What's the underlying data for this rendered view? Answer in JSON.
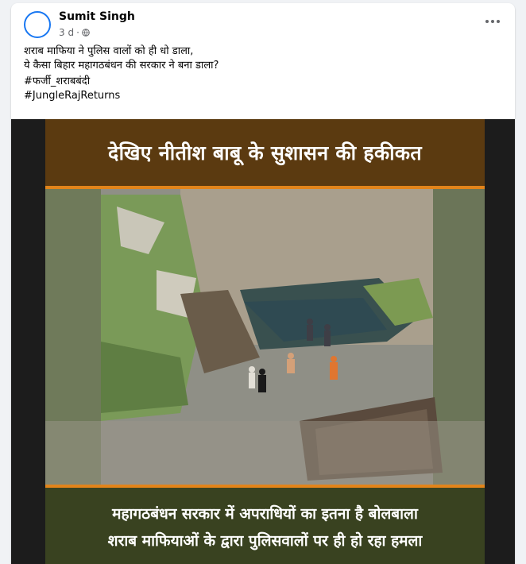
{
  "post": {
    "author": "Sumit Singh",
    "time": "3 d",
    "separator": "·",
    "lines": [
      "शराब माफिया ने पुलिस वालों को ही धो डाला,",
      "ये कैसा बिहार महागठबंधन की सरकार ने बना डाला?"
    ],
    "hashtags": [
      "#फर्जी_शराबबंदी",
      "#JungleRajReturns"
    ]
  },
  "icons": {
    "privacy": "globe-icon",
    "menu": "more-options-icon"
  },
  "video": {
    "top_caption": "देखिए नीतीश बाबू के सुशासन की हकीकत",
    "bottom_caption_lines": [
      "महागठबंधन सरकार में अपराधियों का इतना है बोलबाला",
      "शराब माफियाओं के द्वारा पुलिसवालों पर ही हो रहा हमला"
    ]
  },
  "colors": {
    "accent_blue": "#1877f2",
    "banner_top": "#5b3a10",
    "banner_bottom": "#394220",
    "banner_stripe": "#e2841a"
  }
}
